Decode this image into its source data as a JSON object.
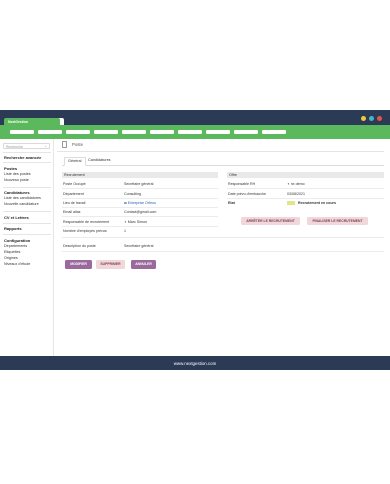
{
  "browser": {
    "tab_title": "NextGestion",
    "window_dots": [
      {
        "name": "yellow",
        "color": "#f0c93a"
      },
      {
        "name": "teal",
        "color": "#45b4c5"
      },
      {
        "name": "red",
        "color": "#e5534b"
      }
    ]
  },
  "colors": {
    "nav": "#5cb85c",
    "chrome": "#2b3a55",
    "primary_button": "#9a6a9d",
    "secondary_button": "#f2d7da"
  },
  "sidebar": {
    "search_placeholder": "Recherche",
    "advanced_search": "Recherche avancée",
    "sections": [
      {
        "title": "Postes",
        "items": [
          "Liste des postes",
          "Nouveau poste"
        ]
      },
      {
        "title": "Candidatures",
        "items": [
          "Liste des candidatures",
          "Nouvelle candidature"
        ]
      },
      {
        "title": "CV et Lettres",
        "items": []
      },
      {
        "title": "Rapports",
        "items": []
      },
      {
        "title": "Configuration",
        "items": [
          "Départements",
          "Etiquettes",
          "Origines",
          "Niveaux d'étude"
        ]
      }
    ]
  },
  "page": {
    "title": "Poste",
    "tabs": [
      "Général",
      "Candidatures"
    ],
    "active_tab": "Général"
  },
  "recruitment": {
    "header": "Recrutement",
    "fields": {
      "poste_occupe": {
        "label": "Poste Occupé",
        "value": "Secrétaire général"
      },
      "departement": {
        "label": "Département",
        "value": "Consulting"
      },
      "lieu_travail": {
        "label": "Lieu de travail",
        "value": "Entreprise Orfeus"
      },
      "email_alias": {
        "label": "Email alias",
        "value": "Contact@gmail.com"
      },
      "responsable_recrutement": {
        "label": "Responsable de recrutement",
        "value": "Marc Simon"
      },
      "nombre_employes": {
        "label": "Nombre d'employés prévus",
        "value": "1"
      },
      "description": {
        "label": "Description du poste",
        "value": "Secrétaire général"
      }
    }
  },
  "offer": {
    "header": "Offre",
    "fields": {
      "responsable_rh": {
        "label": "Responsable RH",
        "value": "nx demo"
      },
      "date_embauche": {
        "label": "Date prévu d'embauche",
        "value": "03/08/2021"
      },
      "etat": {
        "label": "Etat",
        "value": "Recrutement en cours"
      }
    },
    "actions": {
      "stop": "ARRÊTER LE RECRUTEMENT",
      "finish": "FINALISER LE RECRUTEMENT"
    }
  },
  "buttons": {
    "modify": "MODIFIER",
    "delete": "SUPPRIMER",
    "cancel": "ANNULER"
  },
  "footer": {
    "text": "www.nextgestion.com"
  }
}
